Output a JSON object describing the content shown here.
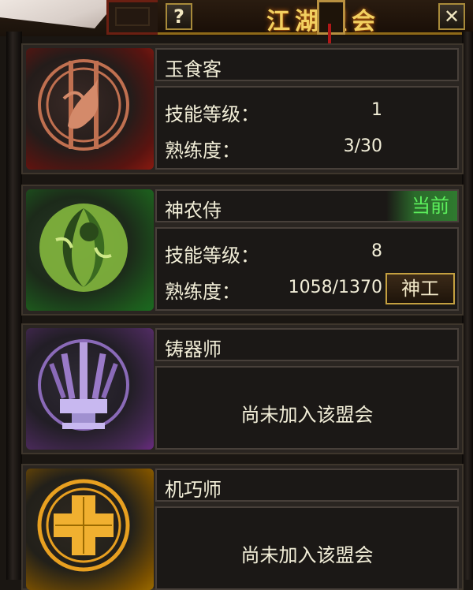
{
  "window": {
    "title": "江湖盟会",
    "help_label": "?",
    "close_label": "✕"
  },
  "colors": {
    "jade_red": "#8a1a10",
    "herb_green": "#1d5a1d",
    "forge_purple": "#5a2a70",
    "craft_orange": "#8a5a00",
    "current_green": "#5cf05c",
    "gold_title": "#f2d060"
  },
  "guilds": [
    {
      "name": "玉食客",
      "icon": "fish-dragon-icon",
      "level_label": "技能等级：",
      "level": "1",
      "proficiency_label": "熟练度：",
      "proficiency": "3/30"
    },
    {
      "name": "神农侍",
      "icon": "leaf-herb-icon",
      "badge": "当前",
      "level_label": "技能等级：",
      "level": "8",
      "proficiency_label": "熟练度：",
      "proficiency": "1058/1370",
      "action_label": "神工"
    },
    {
      "name": "铸器师",
      "icon": "anvil-weapons-icon",
      "status": "尚未加入该盟会"
    },
    {
      "name": "机巧师",
      "icon": "gear-cross-icon",
      "status": "尚未加入该盟会"
    }
  ]
}
